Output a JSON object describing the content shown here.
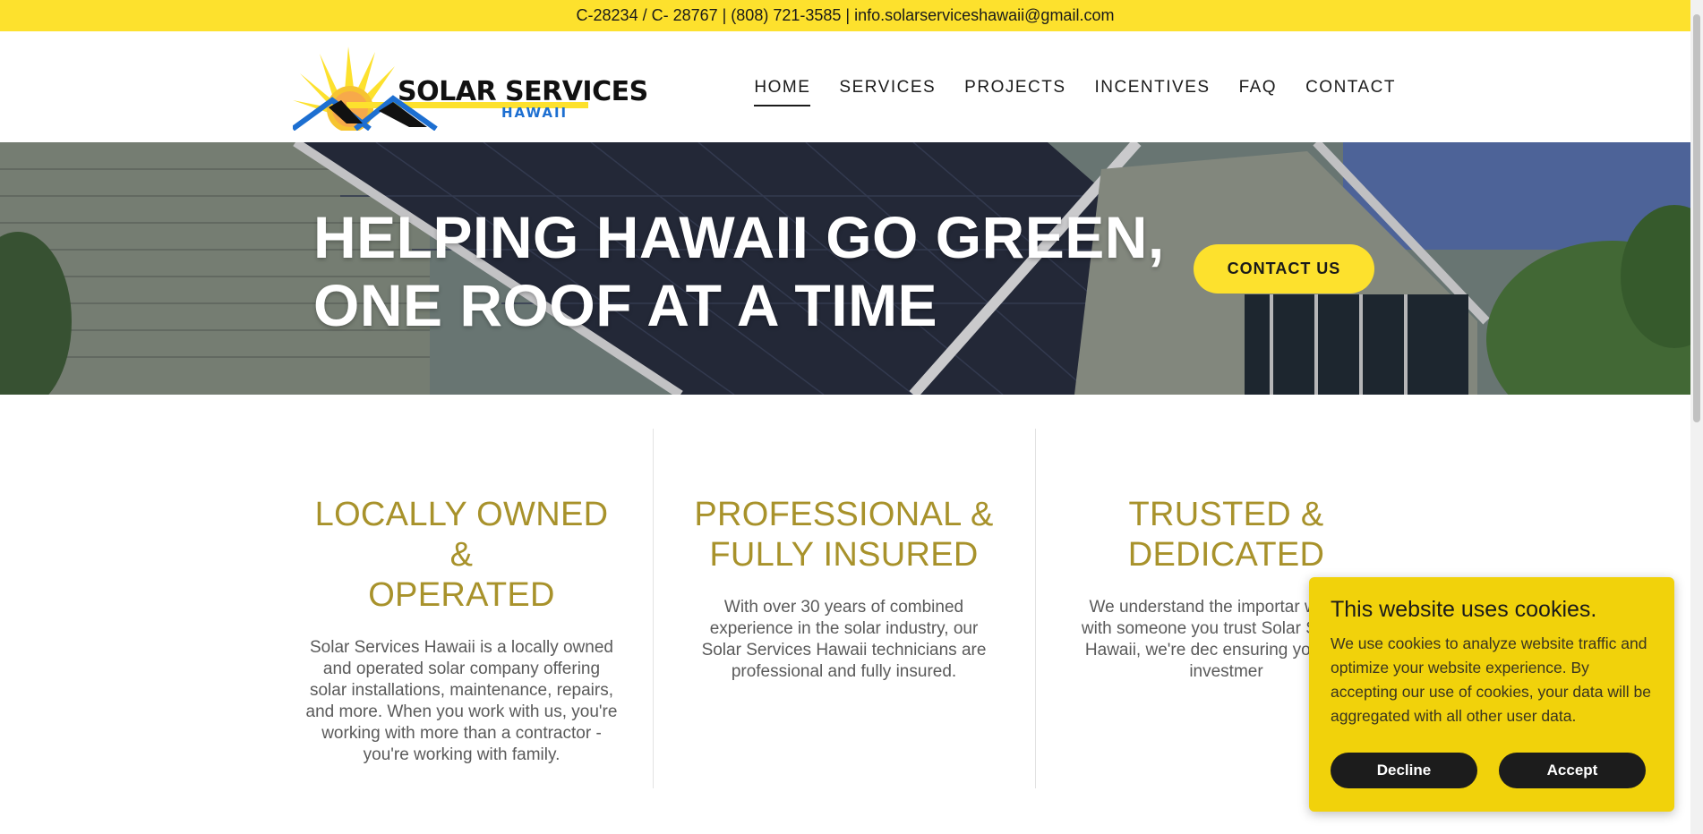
{
  "topbar": {
    "text": "C-28234 / C- 28767 | (808) 721-3585 | info.solarserviceshawaii@gmail.com"
  },
  "logo": {
    "line1": "SOLAR SERVICES",
    "line2": "HAWAII"
  },
  "nav": {
    "items": [
      {
        "label": "HOME"
      },
      {
        "label": "SERVICES"
      },
      {
        "label": "PROJECTS"
      },
      {
        "label": "INCENTIVES"
      },
      {
        "label": "FAQ"
      },
      {
        "label": "CONTACT"
      }
    ]
  },
  "hero": {
    "title_line1": "HELPING HAWAII GO GREEN,",
    "title_line2": "ONE ROOF AT A TIME",
    "cta_label": "CONTACT US"
  },
  "features": [
    {
      "title_line1": "LOCALLY OWNED &",
      "title_line2": "OPERATED",
      "body": "Solar Services Hawaii is a locally owned and operated solar company offering solar installations, maintenance, repairs, and more. When you work with us, you're working with more than a contractor - you're working with family."
    },
    {
      "title_line1": "PROFESSIONAL &",
      "title_line2": "FULLY INSURED",
      "body": "With over 30 years of combined experience in the solar industry, our Solar Services Hawaii technicians are professional and fully insured."
    },
    {
      "title_line1": "TRUSTED &",
      "title_line2": "DEDICATED",
      "body": "We understand the importar working with someone you trust Solar Services Hawaii, we're dec ensuring your solar investmer"
    }
  ],
  "cookie": {
    "title": "This website uses cookies.",
    "text": "We use cookies to analyze website traffic and optimize your website experience. By accepting our use of cookies, your data will be aggregated with all other user data.",
    "decline_label": "Decline",
    "accept_label": "Accept"
  },
  "colors": {
    "accent_yellow": "#fde12d",
    "cookie_yellow": "#f1d20b",
    "heading_gold": "#a8922b",
    "logo_blue": "#1d6fd1"
  }
}
